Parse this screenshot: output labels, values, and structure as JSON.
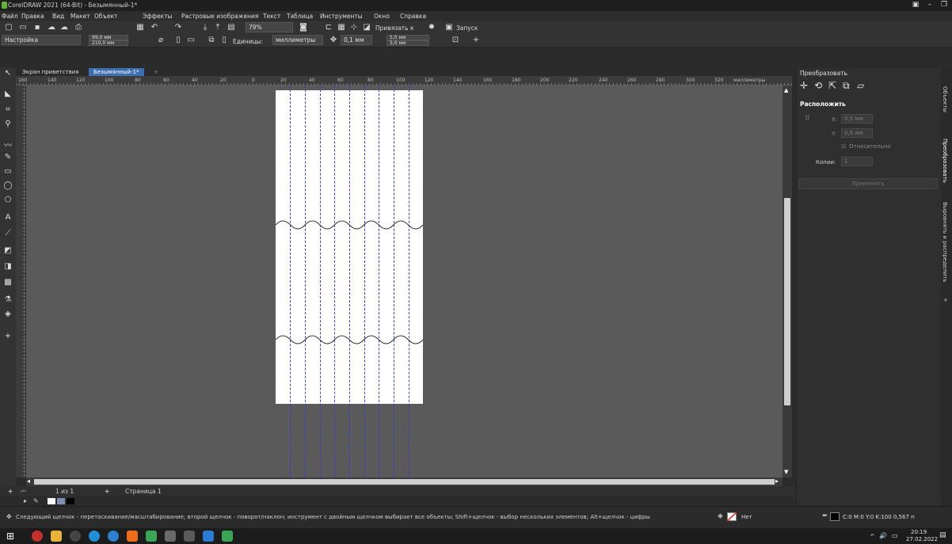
{
  "window": {
    "title": "CorelDRAW 2021 (64-Bit) - Безымянный-1*"
  },
  "menu": [
    "Файл",
    "Правка",
    "Вид",
    "Макет",
    "Объект",
    "Эффекты",
    "Растровые изображения",
    "Текст",
    "Таблица",
    "Инструменты",
    "Окно",
    "Справка"
  ],
  "toolbar": {
    "zoom": "79%",
    "snap_label": "Привязать к",
    "launch_label": "Запуск",
    "preset": "Настройка",
    "width": "99,0 мм",
    "height": "210,0 мм",
    "units_label": "Единицы:",
    "units_value": "миллиметры",
    "nudge": "0,1 мм",
    "dup_x": "5,0 мм",
    "dup_y": "5,0 мм"
  },
  "tabs": {
    "welcome": "Экран приветствия",
    "document": "Безымянный-1*"
  },
  "ruler": {
    "h_labels": [
      "160",
      "140",
      "120",
      "100",
      "80",
      "60",
      "40",
      "20",
      "0",
      "20",
      "40",
      "60",
      "80",
      "100",
      "120",
      "140",
      "160",
      "180",
      "200",
      "220",
      "240",
      "260",
      "280",
      "300",
      "320"
    ],
    "units": "миллиметры"
  },
  "pagebar": {
    "page_count": "1 из 1",
    "page_tab": "Страница 1"
  },
  "dock": {
    "title": "Преобразовать",
    "section": "Расположить",
    "x_label": "X:",
    "x_value": "0,0 мм",
    "y_label": "Y:",
    "y_value": "0,0 мм",
    "relative": "Относительно",
    "copies_label": "Копии:",
    "copies_value": "1",
    "apply": "Применить"
  },
  "side_tabs": [
    "Объекты",
    "Преобразовать",
    "Выровнять и распределить"
  ],
  "status": {
    "message": "Следующий щелчок - перетаскивание/масштабирование; второй щелчок - поворот/наклон; инструмент с двойным щелчком выбирает все объекты; Shift+щелчок - выбор нескольких элементов; Alt+щелчок - цифры",
    "fill": "Нет",
    "outline": "C:0 M:0 Y:0 K:100  0,567 п"
  },
  "taskbar": {
    "time": "20:19",
    "date": "27.02.2022"
  },
  "colors": {
    "guide": "#3b3bd6",
    "page": "#ffffff",
    "desk": "#5a5a5a",
    "accent": "#5fb336"
  }
}
